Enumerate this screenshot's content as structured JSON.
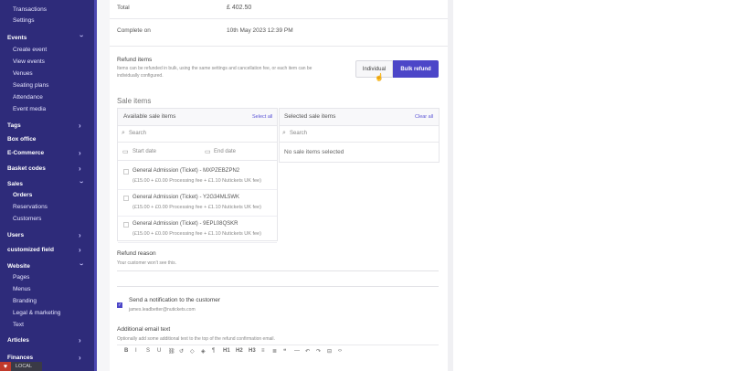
{
  "sidebar": {
    "items": [
      {
        "label": "Transactions",
        "kind": "sub"
      },
      {
        "label": "Settings",
        "kind": "sub"
      },
      {
        "label": "Events",
        "kind": "sec",
        "chev": "down"
      },
      {
        "label": "Create event",
        "kind": "sub"
      },
      {
        "label": "View events",
        "kind": "sub"
      },
      {
        "label": "Venues",
        "kind": "sub"
      },
      {
        "label": "Seating plans",
        "kind": "sub"
      },
      {
        "label": "Attendance",
        "kind": "sub"
      },
      {
        "label": "Event media",
        "kind": "sub"
      },
      {
        "label": "Tags",
        "kind": "sec",
        "chev": "right"
      },
      {
        "label": "Box office",
        "kind": "sec"
      },
      {
        "label": "E-Commerce",
        "kind": "sec",
        "chev": "right"
      },
      {
        "label": "Basket codes",
        "kind": "sec",
        "chev": "right"
      },
      {
        "label": "Sales",
        "kind": "sec",
        "chev": "down"
      },
      {
        "label": "Orders",
        "kind": "sub",
        "active": true
      },
      {
        "label": "Reservations",
        "kind": "sub"
      },
      {
        "label": "Customers",
        "kind": "sub"
      },
      {
        "label": "Users",
        "kind": "sec",
        "chev": "right"
      },
      {
        "label": "customized field",
        "kind": "sec",
        "chev": "right"
      },
      {
        "label": "Website",
        "kind": "sec",
        "chev": "down"
      },
      {
        "label": "Pages",
        "kind": "sub"
      },
      {
        "label": "Menus",
        "kind": "sub"
      },
      {
        "label": "Branding",
        "kind": "sub"
      },
      {
        "label": "Legal & marketing",
        "kind": "sub"
      },
      {
        "label": "Text",
        "kind": "sub"
      },
      {
        "label": "Articles",
        "kind": "sec",
        "chev": "right"
      },
      {
        "label": "Finances",
        "kind": "sec",
        "chev": "right"
      }
    ],
    "env_badge": "LOCAL"
  },
  "summary": {
    "total_label": "Total",
    "total_value": "£ 402.50",
    "complete_label": "Complete on",
    "complete_value": "10th May 2023 12:39 PM"
  },
  "refund_items": {
    "title": "Refund items",
    "description_line1": "Items can be refunded in bulk, using the same settings and cancellation fee, or each item can be",
    "description_line2": "individually configured.",
    "individual_label": "Individual",
    "bulk_label": "Bulk refund"
  },
  "sale_items": {
    "title": "Sale items",
    "available_title": "Available sale items",
    "select_all": "Select all",
    "selected_title": "Selected sale items",
    "clear_all": "Clear all",
    "search_placeholder_left": "Search",
    "search_placeholder_right": "Search",
    "start_date_placeholder": "Start date",
    "end_date_placeholder": "End date",
    "empty_selected": "No sale items selected",
    "items": [
      {
        "name": "General Admission (Ticket) - MXPZEBZPN2",
        "price": "(£15.00 + £0.00 Processing fee + £1.10 Nutickets UK fee)"
      },
      {
        "name": "General Admission (Ticket) - Y2G34ML5WK",
        "price": "(£15.00 + £0.00 Processing fee + £1.10 Nutickets UK fee)"
      },
      {
        "name": "General Admission (Ticket) - 9EPL08QSKR",
        "price": "(£15.00 + £0.00 Processing fee + £1.10 Nutickets UK fee)"
      }
    ]
  },
  "refund_reason": {
    "title": "Refund reason",
    "hint": "Your customer won't see this."
  },
  "notify": {
    "label": "Send a notification to the customer",
    "email": "james.leadbetter@nutickets.com",
    "checked": true
  },
  "additional_email": {
    "title": "Additional email text",
    "hint": "Optionally add some additional text to the top of the refund confirmation email.",
    "toolbar": [
      "B",
      "I",
      "S",
      "U",
      "⛓",
      "↺",
      "◇",
      "◈",
      "¶",
      "H1",
      "H2",
      "H3",
      "≡",
      "≣",
      "❝",
      "—",
      "↶",
      "↷",
      "⊟",
      "‹›"
    ]
  }
}
